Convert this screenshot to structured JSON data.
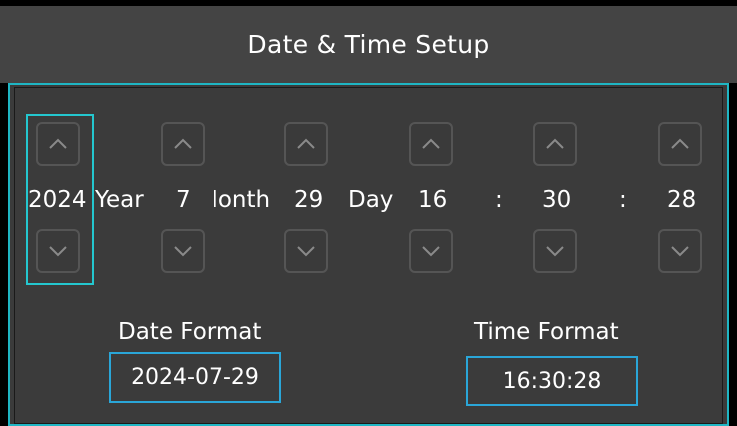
{
  "window": {
    "title": "Date & Time Setup"
  },
  "fields": [
    {
      "value": "2024",
      "unit": "Year"
    },
    {
      "value": "7",
      "unit": "Month"
    },
    {
      "value": "29",
      "unit": "Day"
    },
    {
      "value": "16",
      "unit": ":"
    },
    {
      "value": "30",
      "unit": ":"
    },
    {
      "value": "28",
      "unit": ""
    }
  ],
  "icons": {
    "up": "chevron-up-icon",
    "down": "chevron-down-icon"
  },
  "date_format": {
    "label": "Date Format",
    "value": "2024-07-29"
  },
  "time_format": {
    "label": "Time Format",
    "value": "16:30:28"
  },
  "colors": {
    "accent": "#24c7cf",
    "format_border": "#2aa6d8",
    "title_bg": "#444444",
    "panel_bg": "#3b3b3b",
    "text": "#ffffff"
  }
}
